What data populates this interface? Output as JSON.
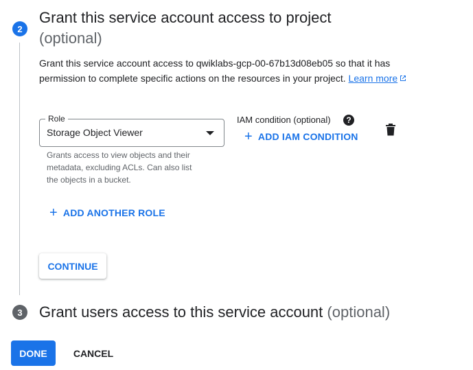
{
  "step2": {
    "number": "2",
    "title": "Grant this service account access to project",
    "optional": "(optional)",
    "description_prefix": "Grant this service account access to qwiklabs-gcp-00-67b13d08eb05 so that it has permission to complete specific actions on the resources in your project.",
    "learn_more_label": "Learn more"
  },
  "role": {
    "label": "Role",
    "value": "Storage Object Viewer",
    "hint": "Grants access to view objects and their metadata, excluding ACLs. Can also list the objects in a bucket."
  },
  "iam": {
    "label": "IAM condition (optional)",
    "add_label": "ADD IAM CONDITION"
  },
  "add_another_role_label": "ADD ANOTHER ROLE",
  "continue_label": "CONTINUE",
  "step3": {
    "number": "3",
    "title": "Grant users access to this service account",
    "optional": "(optional)"
  },
  "footer": {
    "done_label": "DONE",
    "cancel_label": "CANCEL"
  },
  "colors": {
    "accent": "#1a73e8",
    "text": "#202124",
    "muted": "#5f6368"
  }
}
